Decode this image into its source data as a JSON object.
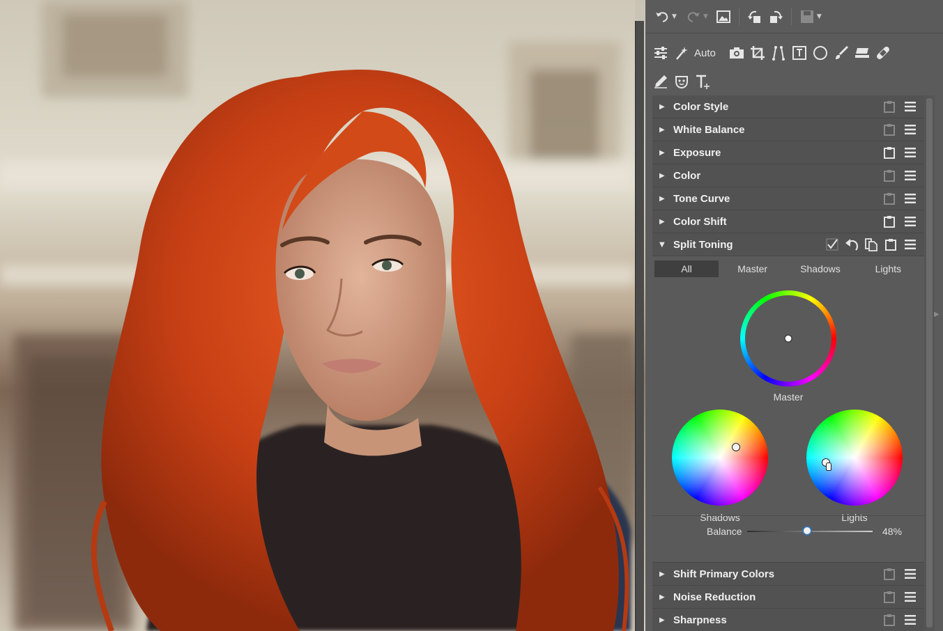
{
  "toolbar": {
    "icons": [
      "undo-icon",
      "redo-icon",
      "image-view-icon",
      "rotate-left-icon",
      "rotate-right-icon",
      "save-icon"
    ]
  },
  "tools": {
    "auto_label": "Auto",
    "row1_icons": [
      "adjust-sliders-icon",
      "auto-wand-icon",
      "camera-icon",
      "crop-icon",
      "perspective-icon",
      "frame-icon",
      "radial-filter-icon",
      "brush-icon",
      "eraser-block-icon",
      "bandage-icon"
    ],
    "row2_icons": [
      "pen-icon",
      "face-mask-icon",
      "text-icon"
    ]
  },
  "sections_top": [
    {
      "title": "Color Style"
    },
    {
      "title": "White Balance"
    },
    {
      "title": "Exposure"
    },
    {
      "title": "Color"
    },
    {
      "title": "Tone Curve"
    },
    {
      "title": "Color Shift"
    }
  ],
  "split_toning": {
    "title": "Split Toning",
    "tabs": [
      "All",
      "Master",
      "Shadows",
      "Lights"
    ],
    "active_tab": "All",
    "wheels": {
      "master": {
        "label": "Master"
      },
      "shadows": {
        "label": "Shadows"
      },
      "lights": {
        "label": "Lights"
      }
    },
    "balance": {
      "label": "Balance",
      "value": "48%",
      "fraction": 0.48
    }
  },
  "sections_bottom": [
    {
      "title": "Shift Primary Colors"
    },
    {
      "title": "Noise Reduction"
    },
    {
      "title": "Sharpness"
    }
  ],
  "colors": {
    "panel_bg": "#5b5b5b",
    "section_bg": "#525252",
    "hair_orange": "#d4461a",
    "accent_blue": "#3a6fa8"
  }
}
